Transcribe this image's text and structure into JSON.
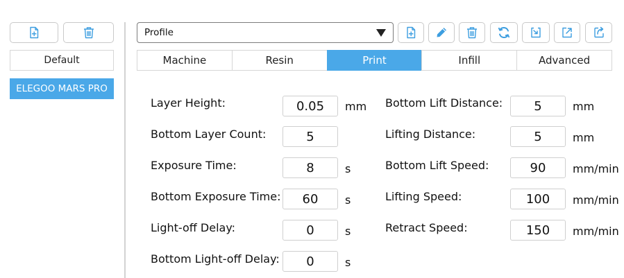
{
  "colors": {
    "accent": "#4aa8e8",
    "icon_blue": "#3d9ee0"
  },
  "left_panel": {
    "profiles": [
      {
        "label": "Default",
        "selected": false
      },
      {
        "label": "ELEGOO MARS PRO",
        "selected": true
      }
    ],
    "toolbar_icons": [
      "add-file-icon",
      "trash-icon"
    ]
  },
  "top_bar": {
    "profile_select": {
      "value": "Profile"
    },
    "toolbar_icons": [
      "add-file-icon",
      "pencil-icon",
      "trash-icon",
      "refresh-icon",
      "import-icon",
      "export-icon",
      "export-alt-icon"
    ]
  },
  "tabs": [
    {
      "label": "Machine",
      "active": false
    },
    {
      "label": "Resin",
      "active": false
    },
    {
      "label": "Print",
      "active": true
    },
    {
      "label": "Infill",
      "active": false
    },
    {
      "label": "Advanced",
      "active": false
    }
  ],
  "print_settings": {
    "left": [
      {
        "label": "Layer Height:",
        "value": "0.05",
        "unit": "mm"
      },
      {
        "label": "Bottom Layer Count:",
        "value": "5",
        "unit": ""
      },
      {
        "label": "Exposure Time:",
        "value": "8",
        "unit": "s"
      },
      {
        "label": "Bottom Exposure Time:",
        "value": "60",
        "unit": "s"
      },
      {
        "label": "Light-off Delay:",
        "value": "0",
        "unit": "s"
      },
      {
        "label": "Bottom Light-off Delay:",
        "value": "0",
        "unit": "s"
      }
    ],
    "right": [
      {
        "label": "Bottom Lift Distance:",
        "value": "5",
        "unit": "mm"
      },
      {
        "label": "Lifting Distance:",
        "value": "5",
        "unit": "mm"
      },
      {
        "label": "Bottom Lift Speed:",
        "value": "90",
        "unit": "mm/min"
      },
      {
        "label": "Lifting Speed:",
        "value": "100",
        "unit": "mm/min"
      },
      {
        "label": "Retract Speed:",
        "value": "150",
        "unit": "mm/min"
      }
    ]
  }
}
